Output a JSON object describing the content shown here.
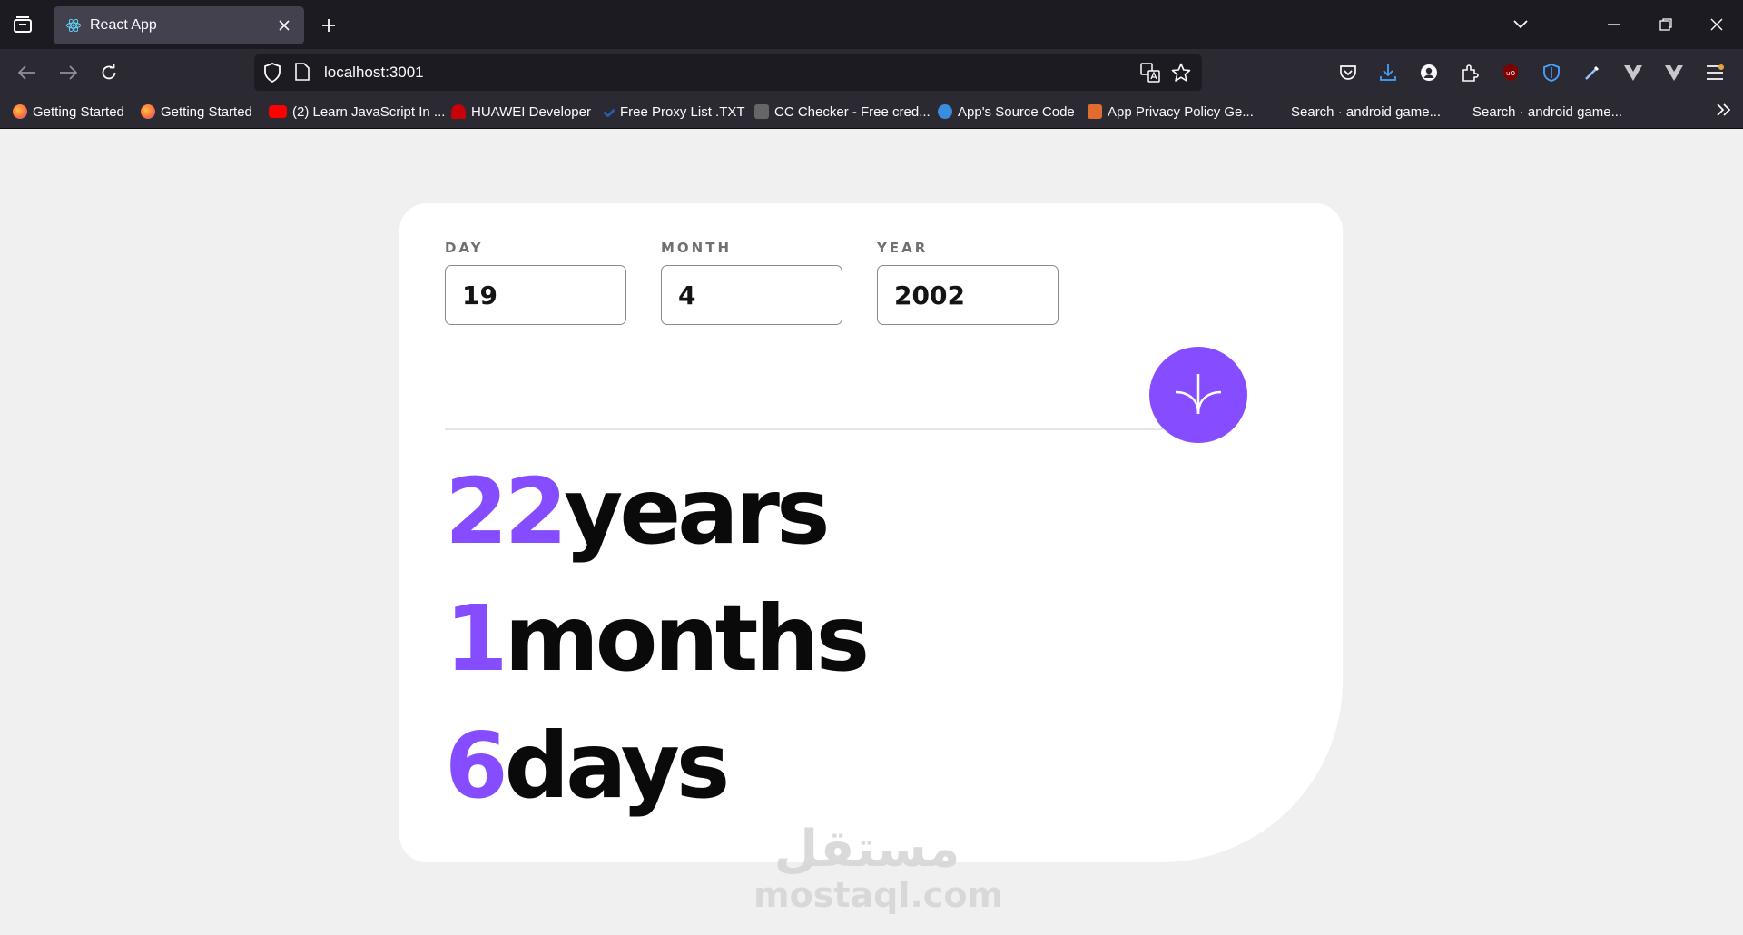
{
  "browser": {
    "tab_title": "React App",
    "url": "localhost:3001",
    "bookmarks": [
      {
        "label": "Getting Started",
        "color": "#ff7139"
      },
      {
        "label": "Getting Started",
        "color": "#ff7139"
      },
      {
        "label": "(2) Learn JavaScript In ...",
        "color": "#ff0000"
      },
      {
        "label": "HUAWEI Developer",
        "color": "#c7000b"
      },
      {
        "label": "Free Proxy List .TXT",
        "color": "#2a5db0"
      },
      {
        "label": "CC Checker - Free cred...",
        "color": "#555555"
      },
      {
        "label": "App's Source Code",
        "color": "#3a8dde"
      },
      {
        "label": "App Privacy Policy Ge...",
        "color": "#e06c2f"
      },
      {
        "label": "Search · android game...",
        "color": "#2b2a33"
      },
      {
        "label": "Search · android game...",
        "color": "#2b2a33"
      }
    ]
  },
  "form": {
    "day": {
      "label": "DAY",
      "value": "19"
    },
    "month": {
      "label": "MONTH",
      "value": "4"
    },
    "year": {
      "label": "YEAR",
      "value": "2002"
    }
  },
  "result": {
    "years": {
      "value": "22",
      "unit": "years"
    },
    "months": {
      "value": "1",
      "unit": "months"
    },
    "days": {
      "value": "6",
      "unit": "days"
    }
  },
  "watermark": {
    "arabic": "مستقل",
    "latin": "mostaql.com"
  },
  "colors": {
    "accent": "#854dff",
    "background": "#f0f0f0",
    "card": "#ffffff"
  }
}
